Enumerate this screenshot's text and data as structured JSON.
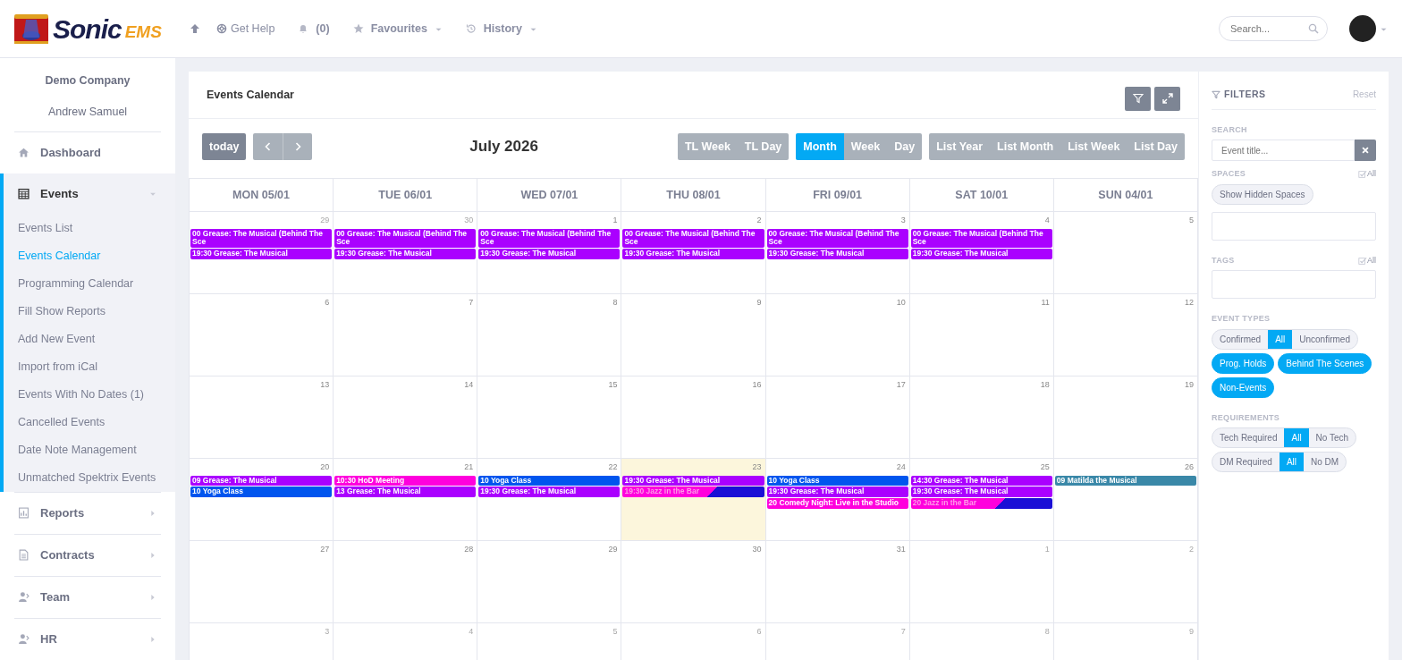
{
  "header": {
    "logo": {
      "word": "Sonic",
      "suffix": "EMS"
    },
    "help": "Get Help",
    "notifications": "(0)",
    "favourites": "Favourites",
    "history": "History",
    "search": {
      "placeholder": "Search..."
    }
  },
  "sidebar": {
    "company": "Demo Company",
    "user": "Andrew Samuel",
    "items": [
      {
        "label": "Dashboard",
        "expandable": false,
        "expanded": false
      },
      {
        "label": "Events",
        "expandable": true,
        "expanded": true,
        "children": [
          {
            "label": "Events List",
            "selected": false
          },
          {
            "label": "Events Calendar",
            "selected": true
          },
          {
            "label": "Programming Calendar",
            "selected": false
          },
          {
            "label": "Fill Show Reports",
            "selected": false
          },
          {
            "label": "Add New Event",
            "selected": false
          },
          {
            "label": "Import from iCal",
            "selected": false
          },
          {
            "label": "Events With No Dates (1)",
            "selected": false
          },
          {
            "label": "Cancelled Events",
            "selected": false
          },
          {
            "label": "Date Note Management",
            "selected": false
          },
          {
            "label": "Unmatched Spektrix Events",
            "selected": false
          }
        ]
      },
      {
        "label": "Reports",
        "expandable": true,
        "expanded": false
      },
      {
        "label": "Contracts",
        "expandable": true,
        "expanded": false
      },
      {
        "label": "Team",
        "expandable": true,
        "expanded": false
      },
      {
        "label": "HR",
        "expandable": true,
        "expanded": false
      }
    ]
  },
  "calendar": {
    "title": "Events Calendar",
    "today_button": "today",
    "month": "July 2026",
    "view_groups": [
      {
        "buttons": [
          {
            "label": "TL Week",
            "selected": false
          },
          {
            "label": "TL Day",
            "selected": false
          }
        ]
      },
      {
        "buttons": [
          {
            "label": "Month",
            "selected": true
          },
          {
            "label": "Week",
            "selected": false
          },
          {
            "label": "Day",
            "selected": false
          }
        ]
      },
      {
        "buttons": [
          {
            "label": "List Year",
            "selected": false
          },
          {
            "label": "List Month",
            "selected": false
          },
          {
            "label": "List Week",
            "selected": false
          },
          {
            "label": "List Day",
            "selected": false
          }
        ]
      }
    ],
    "day_headers": [
      "MON 05/01",
      "TUE 06/01",
      "WED 07/01",
      "THU 08/01",
      "FRI 09/01",
      "SAT 10/01",
      "SUN 04/01"
    ],
    "weeks": [
      {
        "days": [
          {
            "number": "29",
            "other_month": true,
            "today": false,
            "events": [
              {
                "text": "00 Grease: The Musical (Behind The Sce",
                "color": "#aa00ff",
                "kind": "plain"
              },
              {
                "text": "19:30 Grease: The Musical",
                "color": "#aa00ff",
                "kind": "plain"
              }
            ]
          },
          {
            "number": "30",
            "other_month": true,
            "today": false,
            "events": [
              {
                "text": "00 Grease: The Musical (Behind The Sce",
                "color": "#aa00ff",
                "kind": "plain"
              },
              {
                "text": "19:30 Grease: The Musical",
                "color": "#aa00ff",
                "kind": "plain"
              }
            ]
          },
          {
            "number": "1",
            "other_month": false,
            "today": false,
            "events": [
              {
                "text": "00 Grease: The Musical (Behind The Sce",
                "color": "#aa00ff",
                "kind": "plain"
              },
              {
                "text": "19:30 Grease: The Musical",
                "color": "#aa00ff",
                "kind": "plain"
              }
            ]
          },
          {
            "number": "2",
            "other_month": false,
            "today": false,
            "events": [
              {
                "text": "00 Grease: The Musical (Behind The Sce",
                "color": "#aa00ff",
                "kind": "plain"
              },
              {
                "text": "19:30 Grease: The Musical",
                "color": "#aa00ff",
                "kind": "plain"
              }
            ]
          },
          {
            "number": "3",
            "other_month": false,
            "today": false,
            "events": [
              {
                "text": "00 Grease: The Musical (Behind The Sce",
                "color": "#aa00ff",
                "kind": "plain"
              },
              {
                "text": "19:30 Grease: The Musical",
                "color": "#aa00ff",
                "kind": "plain"
              }
            ]
          },
          {
            "number": "4",
            "other_month": false,
            "today": false,
            "events": [
              {
                "text": "00 Grease: The Musical (Behind The Sce",
                "color": "#aa00ff",
                "kind": "plain"
              },
              {
                "text": "19:30 Grease: The Musical",
                "color": "#aa00ff",
                "kind": "plain"
              }
            ]
          },
          {
            "number": "5",
            "other_month": false,
            "today": false
          }
        ]
      },
      {
        "days": [
          {
            "number": "6",
            "other_month": false,
            "today": false
          },
          {
            "number": "7",
            "other_month": false,
            "today": false
          },
          {
            "number": "8",
            "other_month": false,
            "today": false
          },
          {
            "number": "9",
            "other_month": false,
            "today": false
          },
          {
            "number": "10",
            "other_month": false,
            "today": false
          },
          {
            "number": "11",
            "other_month": false,
            "today": false
          },
          {
            "number": "12",
            "other_month": false,
            "today": false
          }
        ]
      },
      {
        "days": [
          {
            "number": "13",
            "other_month": false,
            "today": false
          },
          {
            "number": "14",
            "other_month": false,
            "today": false
          },
          {
            "number": "15",
            "other_month": false,
            "today": false
          },
          {
            "number": "16",
            "other_month": false,
            "today": false
          },
          {
            "number": "17",
            "other_month": false,
            "today": false
          },
          {
            "number": "18",
            "other_month": false,
            "today": false
          },
          {
            "number": "19",
            "other_month": false,
            "today": false
          }
        ]
      },
      {
        "days": [
          {
            "number": "20",
            "other_month": false,
            "today": false,
            "events": [
              {
                "text": "09 Grease: The Musical",
                "color": "#aa00ff",
                "kind": "plain"
              },
              {
                "text": "10 Yoga Class",
                "color": "#0055ee",
                "kind": "plain"
              }
            ]
          },
          {
            "number": "21",
            "other_month": false,
            "today": false,
            "events": [
              {
                "text": "10:30 HoD Meeting",
                "color": "#ff00dd",
                "kind": "plain"
              },
              {
                "text": "13 Grease: The Musical",
                "color": "#aa00ff",
                "kind": "plain"
              }
            ]
          },
          {
            "number": "22",
            "other_month": false,
            "today": false,
            "events": [
              {
                "text": "10 Yoga Class",
                "color": "#0055ee",
                "kind": "plain"
              },
              {
                "text": "19:30 Grease: The Musical",
                "color": "#aa00ff",
                "kind": "plain"
              }
            ]
          },
          {
            "number": "23",
            "other_month": false,
            "today": true,
            "events": [
              {
                "text": "19:30 Grease: The Musical",
                "color": "#aa00ff",
                "kind": "plain"
              },
              {
                "text": "19:30 Jazz in the Bar",
                "color": "#ff00dd",
                "kind": "split"
              }
            ]
          },
          {
            "number": "24",
            "other_month": false,
            "today": false,
            "events": [
              {
                "text": "10 Yoga Class",
                "color": "#0055ee",
                "kind": "plain"
              },
              {
                "text": "19:30 Grease: The Musical",
                "color": "#aa00ff",
                "kind": "plain"
              },
              {
                "text": "20 Comedy Night: Live in the Studio",
                "color": "#ff00dd",
                "kind": "plain"
              }
            ]
          },
          {
            "number": "25",
            "other_month": false,
            "today": false,
            "events": [
              {
                "text": "14:30 Grease: The Musical",
                "color": "#aa00ff",
                "kind": "plain"
              },
              {
                "text": "19:30 Grease: The Musical",
                "color": "#aa00ff",
                "kind": "plain"
              },
              {
                "text": "20 Jazz in the Bar",
                "color": "#ff00dd",
                "kind": "split"
              }
            ]
          },
          {
            "number": "26",
            "other_month": false,
            "today": false,
            "events": [
              {
                "text": "09 Matilda the Musical",
                "color": "#3a88a8",
                "kind": "plain"
              }
            ]
          }
        ]
      },
      {
        "days": [
          {
            "number": "27",
            "other_month": false,
            "today": false
          },
          {
            "number": "28",
            "other_month": false,
            "today": false
          },
          {
            "number": "29",
            "other_month": false,
            "today": false
          },
          {
            "number": "30",
            "other_month": false,
            "today": false
          },
          {
            "number": "31",
            "other_month": false,
            "today": false
          },
          {
            "number": "1",
            "other_month": true,
            "today": false
          },
          {
            "number": "2",
            "other_month": true,
            "today": false
          }
        ]
      },
      {
        "days": [
          {
            "number": "3",
            "other_month": true,
            "today": false
          },
          {
            "number": "4",
            "other_month": true,
            "today": false
          },
          {
            "number": "5",
            "other_month": true,
            "today": false
          },
          {
            "number": "6",
            "other_month": true,
            "today": false
          },
          {
            "number": "7",
            "other_month": true,
            "today": false
          },
          {
            "number": "8",
            "other_month": true,
            "today": false
          },
          {
            "number": "9",
            "other_month": true,
            "today": false
          }
        ]
      }
    ]
  },
  "filters": {
    "title": "FILTERS",
    "reset": "Reset",
    "search_label": "SEARCH",
    "search": {
      "placeholder": "Event title..."
    },
    "spaces_label": "SPACES",
    "spaces_all": "All",
    "show_hidden": "Show Hidden Spaces",
    "tags_label": "TAGS",
    "tags_all": "All",
    "event_types_label": "EVENT TYPES",
    "event_types": [
      {
        "label": "Confirmed",
        "selected": false
      },
      {
        "label": "All",
        "selected": true
      },
      {
        "label": "Unconfirmed",
        "selected": false
      }
    ],
    "type_toggles": [
      {
        "label": "Prog. Holds",
        "on": true
      },
      {
        "label": "Behind The Scenes",
        "on": true
      },
      {
        "label": "Non-Events",
        "on": true
      }
    ],
    "requirements_label": "REQUIREMENTS",
    "requirements": [
      {
        "options": [
          {
            "label": "Tech Required",
            "selected": false
          },
          {
            "label": "All",
            "selected": true
          },
          {
            "label": "No Tech",
            "selected": false
          }
        ]
      },
      {
        "options": [
          {
            "label": "DM Required",
            "selected": false
          },
          {
            "label": "All",
            "selected": true
          },
          {
            "label": "No DM",
            "selected": false
          }
        ]
      }
    ]
  }
}
